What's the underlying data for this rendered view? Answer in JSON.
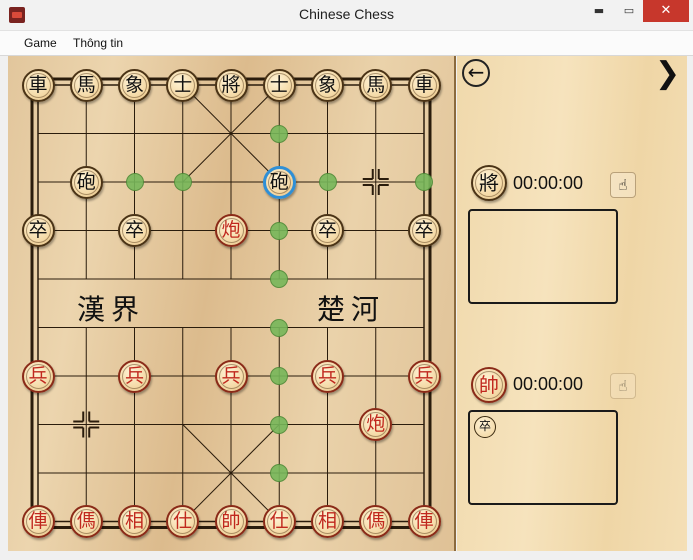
{
  "window": {
    "title": "Chinese Chess",
    "minimize": "▬",
    "maximize": "▭",
    "close": "✕"
  },
  "menu": {
    "items": [
      "Game",
      "Thông tin"
    ]
  },
  "board": {
    "river": {
      "left": "漢界",
      "right": "楚河"
    },
    "pieces": [
      {
        "side": "black",
        "char": "車",
        "col": 0,
        "row": 0
      },
      {
        "side": "black",
        "char": "馬",
        "col": 1,
        "row": 0
      },
      {
        "side": "black",
        "char": "象",
        "col": 2,
        "row": 0
      },
      {
        "side": "black",
        "char": "士",
        "col": 3,
        "row": 0
      },
      {
        "side": "black",
        "char": "將",
        "col": 4,
        "row": 0
      },
      {
        "side": "black",
        "char": "士",
        "col": 5,
        "row": 0
      },
      {
        "side": "black",
        "char": "象",
        "col": 6,
        "row": 0
      },
      {
        "side": "black",
        "char": "馬",
        "col": 7,
        "row": 0
      },
      {
        "side": "black",
        "char": "車",
        "col": 8,
        "row": 0
      },
      {
        "side": "black",
        "char": "砲",
        "col": 1,
        "row": 2
      },
      {
        "side": "black",
        "char": "砲",
        "col": 5,
        "row": 2,
        "selected": true
      },
      {
        "side": "black",
        "char": "卒",
        "col": 0,
        "row": 3
      },
      {
        "side": "black",
        "char": "卒",
        "col": 2,
        "row": 3
      },
      {
        "side": "black",
        "char": "卒",
        "col": 6,
        "row": 3
      },
      {
        "side": "black",
        "char": "卒",
        "col": 8,
        "row": 3
      },
      {
        "side": "red",
        "char": "炮",
        "col": 4,
        "row": 3
      },
      {
        "side": "red",
        "char": "兵",
        "col": 0,
        "row": 6
      },
      {
        "side": "red",
        "char": "兵",
        "col": 2,
        "row": 6
      },
      {
        "side": "red",
        "char": "兵",
        "col": 4,
        "row": 6
      },
      {
        "side": "red",
        "char": "兵",
        "col": 6,
        "row": 6
      },
      {
        "side": "red",
        "char": "兵",
        "col": 8,
        "row": 6
      },
      {
        "side": "red",
        "char": "炮",
        "col": 7,
        "row": 7
      },
      {
        "side": "red",
        "char": "俥",
        "col": 0,
        "row": 9
      },
      {
        "side": "red",
        "char": "傌",
        "col": 1,
        "row": 9
      },
      {
        "side": "red",
        "char": "相",
        "col": 2,
        "row": 9
      },
      {
        "side": "red",
        "char": "仕",
        "col": 3,
        "row": 9
      },
      {
        "side": "red",
        "char": "帥",
        "col": 4,
        "row": 9
      },
      {
        "side": "red",
        "char": "仕",
        "col": 5,
        "row": 9
      },
      {
        "side": "red",
        "char": "相",
        "col": 6,
        "row": 9
      },
      {
        "side": "red",
        "char": "傌",
        "col": 7,
        "row": 9
      },
      {
        "side": "red",
        "char": "俥",
        "col": 8,
        "row": 9
      }
    ],
    "move_hints": [
      {
        "col": 5,
        "row": 1
      },
      {
        "col": 2,
        "row": 2
      },
      {
        "col": 3,
        "row": 2
      },
      {
        "col": 6,
        "row": 2
      },
      {
        "col": 8,
        "row": 2
      },
      {
        "col": 5,
        "row": 3
      },
      {
        "col": 5,
        "row": 4
      },
      {
        "col": 5,
        "row": 5
      },
      {
        "col": 5,
        "row": 6
      },
      {
        "col": 5,
        "row": 7
      },
      {
        "col": 5,
        "row": 8
      }
    ],
    "position_markers": [
      {
        "col": 7,
        "row": 2
      },
      {
        "col": 1,
        "row": 7
      }
    ]
  },
  "panel": {
    "back_icon": "←",
    "next_icon": "❯",
    "black_player": {
      "piece": "將",
      "time": "00:00:00",
      "hand_icon": "☝"
    },
    "red_player": {
      "piece": "帥",
      "time": "00:00:00",
      "hand_icon": "☝"
    },
    "black_captured": [],
    "red_captured": [
      {
        "char": "卒",
        "side": "black"
      }
    ]
  }
}
